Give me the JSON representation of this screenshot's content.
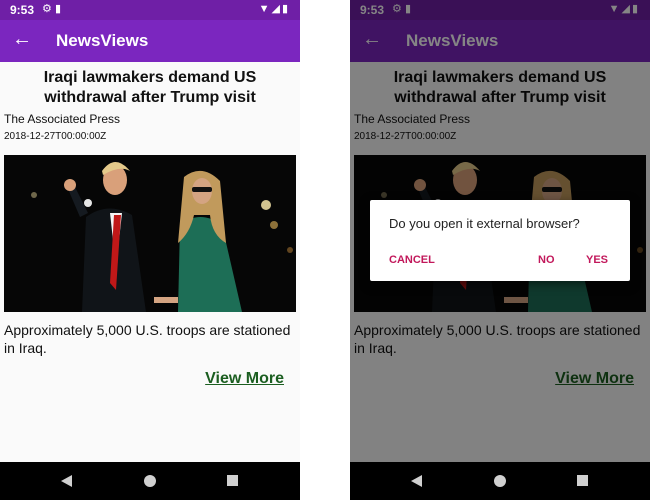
{
  "colors": {
    "status_bar": "#6f1fa6",
    "app_bar": "#7b26bf",
    "link": "#1b5e20",
    "dialog_button": "#c2185b"
  },
  "status_bar": {
    "time": "9:53"
  },
  "app_bar": {
    "title": "NewsViews"
  },
  "article": {
    "title": "Iraqi lawmakers demand US withdrawal after Trump visit",
    "source": "The Associated Press",
    "date": "2018-12-27T00:00:00Z",
    "summary": "Approximately 5,000 U.S. troops are stationed in Iraq.",
    "view_more": "View More"
  },
  "dialog": {
    "message": "Do you open it external browser?",
    "cancel": "CANCEL",
    "no": "NO",
    "yes": "YES"
  }
}
